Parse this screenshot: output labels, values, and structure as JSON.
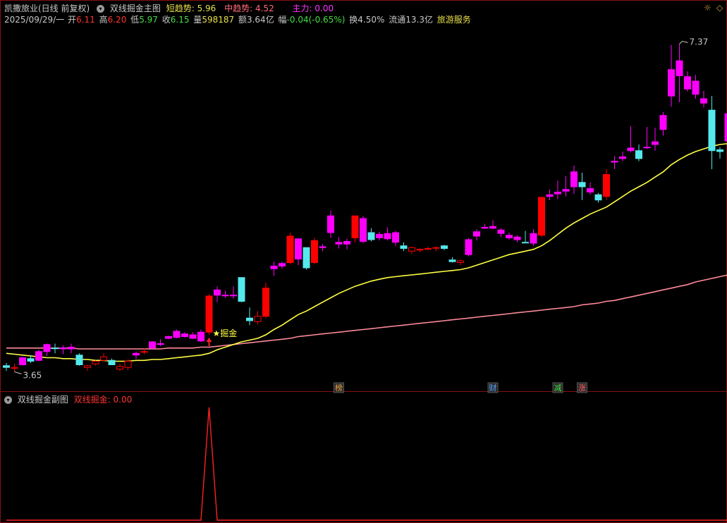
{
  "header": {
    "stock_name": "凯撒旅业(日线 前复权)",
    "indicator_name": "双线掘金主图",
    "short_trend_label": "短趋势:",
    "short_trend_value": "5.96",
    "mid_trend_label": "中趋势:",
    "mid_trend_value": "4.52",
    "main_force_label": "主力:",
    "main_force_value": "0.00"
  },
  "quote": {
    "date": "2025/09/29/一",
    "open_label": "开",
    "open_value": "6.11",
    "high_label": "高",
    "high_value": "6.20",
    "low_label": "低",
    "low_value": "5.97",
    "close_label": "收",
    "close_value": "6.15",
    "volume_label": "量",
    "volume_value": "598187",
    "amount_label": "额",
    "amount_value": "3.64亿",
    "change_label": "幅",
    "change_value": "-0.04(-0.65%)",
    "turnover_label": "换",
    "turnover_value": "4.50%",
    "float_label": "流通",
    "float_value": "13.3亿",
    "sector": "旅游服务"
  },
  "sub_panel": {
    "title": "双线掘金副图",
    "indicator_label": "双线掘金:",
    "indicator_value": "0.00"
  },
  "annotations": {
    "max_price": "7.37",
    "min_price": "3.65",
    "signal_label": "★掘金",
    "events": [
      "榜",
      "财",
      "减",
      "涨"
    ]
  },
  "colors": {
    "background": "#000000",
    "up": "#ff0000",
    "down": "#55e8ec",
    "signal_up": "#ff00ff",
    "ma_short": "#ffff44",
    "ma_long": "#ff8a9a",
    "text_yellow": "#e8e04a",
    "text_red": "#ff3333",
    "text_magenta": "#ff33ff",
    "text_green": "#44dd44",
    "text_grey": "#c8c8c8"
  },
  "chart_data": {
    "type": "candlestick",
    "candles": [
      {
        "o": 3.72,
        "h": 3.75,
        "l": 3.66,
        "c": 3.7,
        "k": "d"
      },
      {
        "o": 3.7,
        "h": 3.74,
        "l": 3.65,
        "c": 3.69,
        "k": "u"
      },
      {
        "o": 3.73,
        "h": 3.82,
        "l": 3.72,
        "c": 3.81,
        "k": "m"
      },
      {
        "o": 3.8,
        "h": 3.84,
        "l": 3.75,
        "c": 3.77,
        "k": "d"
      },
      {
        "o": 3.78,
        "h": 3.9,
        "l": 3.77,
        "c": 3.88,
        "k": "m"
      },
      {
        "o": 3.88,
        "h": 3.97,
        "l": 3.83,
        "c": 3.96,
        "k": "m"
      },
      {
        "o": 3.92,
        "h": 3.97,
        "l": 3.86,
        "c": 3.92,
        "k": "d"
      },
      {
        "o": 3.91,
        "h": 3.95,
        "l": 3.85,
        "c": 3.92,
        "k": "m"
      },
      {
        "o": 3.93,
        "h": 3.97,
        "l": 3.86,
        "c": 3.91,
        "k": "m"
      },
      {
        "o": 3.84,
        "h": 3.86,
        "l": 3.72,
        "c": 3.73,
        "k": "d"
      },
      {
        "o": 3.7,
        "h": 3.73,
        "l": 3.66,
        "c": 3.72,
        "k": "u"
      },
      {
        "o": 3.74,
        "h": 3.78,
        "l": 3.72,
        "c": 3.77,
        "k": "u"
      },
      {
        "o": 3.78,
        "h": 3.86,
        "l": 3.77,
        "c": 3.82,
        "k": "u"
      },
      {
        "o": 3.78,
        "h": 3.8,
        "l": 3.73,
        "c": 3.73,
        "k": "d"
      },
      {
        "o": 3.68,
        "h": 3.74,
        "l": 3.66,
        "c": 3.71,
        "k": "u"
      },
      {
        "o": 3.7,
        "h": 3.79,
        "l": 3.67,
        "c": 3.77,
        "k": "u"
      },
      {
        "o": 3.86,
        "h": 3.88,
        "l": 3.8,
        "c": 3.84,
        "k": "m"
      },
      {
        "o": 3.88,
        "h": 3.92,
        "l": 3.85,
        "c": 3.88,
        "k": "u"
      },
      {
        "o": 3.92,
        "h": 4.0,
        "l": 3.91,
        "c": 3.99,
        "k": "m"
      },
      {
        "o": 3.96,
        "h": 4.02,
        "l": 3.94,
        "c": 3.97,
        "k": "m"
      },
      {
        "o": 4.03,
        "h": 4.06,
        "l": 4.02,
        "c": 4.05,
        "k": "m"
      },
      {
        "o": 4.04,
        "h": 4.13,
        "l": 4.03,
        "c": 4.11,
        "k": "m"
      },
      {
        "o": 4.05,
        "h": 4.1,
        "l": 4.04,
        "c": 4.08,
        "k": "m"
      },
      {
        "o": 4.03,
        "h": 4.1,
        "l": 4.02,
        "c": 4.07,
        "k": "m"
      },
      {
        "o": 4.0,
        "h": 4.13,
        "l": 3.99,
        "c": 4.1,
        "k": "m"
      },
      {
        "o": 4.1,
        "h": 4.53,
        "l": 4.07,
        "c": 4.51,
        "k": "u"
      },
      {
        "o": 4.52,
        "h": 4.62,
        "l": 4.44,
        "c": 4.58,
        "k": "m"
      },
      {
        "o": 4.52,
        "h": 4.57,
        "l": 4.49,
        "c": 4.52,
        "k": "m"
      },
      {
        "o": 4.52,
        "h": 4.62,
        "l": 4.48,
        "c": 4.52,
        "k": "m"
      },
      {
        "o": 4.45,
        "h": 4.72,
        "l": 4.44,
        "c": 4.72,
        "k": "d"
      },
      {
        "o": 4.23,
        "h": 4.38,
        "l": 4.18,
        "c": 4.26,
        "k": "d"
      },
      {
        "o": 4.22,
        "h": 4.34,
        "l": 4.19,
        "c": 4.28,
        "k": "u"
      },
      {
        "o": 4.28,
        "h": 4.66,
        "l": 4.26,
        "c": 4.6,
        "k": "u"
      },
      {
        "o": 4.82,
        "h": 4.9,
        "l": 4.74,
        "c": 4.85,
        "k": "m"
      },
      {
        "o": 4.85,
        "h": 4.9,
        "l": 4.82,
        "c": 4.88,
        "k": "m"
      },
      {
        "o": 4.89,
        "h": 5.23,
        "l": 4.87,
        "c": 5.19,
        "k": "u"
      },
      {
        "o": 4.93,
        "h": 5.16,
        "l": 4.86,
        "c": 5.16,
        "k": "m"
      },
      {
        "o": 4.83,
        "h": 5.06,
        "l": 4.81,
        "c": 5.06,
        "k": "d"
      },
      {
        "o": 4.89,
        "h": 5.17,
        "l": 4.87,
        "c": 5.14,
        "k": "u"
      },
      {
        "o": 5.07,
        "h": 5.1,
        "l": 5.02,
        "c": 5.06,
        "k": "m"
      },
      {
        "o": 5.42,
        "h": 5.48,
        "l": 5.17,
        "c": 5.23,
        "k": "m"
      },
      {
        "o": 5.12,
        "h": 5.18,
        "l": 5.05,
        "c": 5.1,
        "k": "m"
      },
      {
        "o": 5.1,
        "h": 5.16,
        "l": 5.04,
        "c": 5.13,
        "k": "m"
      },
      {
        "o": 5.17,
        "h": 5.42,
        "l": 5.12,
        "c": 5.42,
        "k": "u"
      },
      {
        "o": 5.39,
        "h": 5.42,
        "l": 5.11,
        "c": 5.13,
        "k": "m"
      },
      {
        "o": 5.15,
        "h": 5.28,
        "l": 5.13,
        "c": 5.23,
        "k": "d"
      },
      {
        "o": 5.21,
        "h": 5.24,
        "l": 5.14,
        "c": 5.17,
        "k": "m"
      },
      {
        "o": 5.16,
        "h": 5.29,
        "l": 5.14,
        "c": 5.22,
        "k": "m"
      },
      {
        "o": 5.23,
        "h": 5.25,
        "l": 5.08,
        "c": 5.12,
        "k": "m"
      },
      {
        "o": 5.08,
        "h": 5.12,
        "l": 5.02,
        "c": 5.05,
        "k": "d"
      },
      {
        "o": 5.02,
        "h": 5.07,
        "l": 4.99,
        "c": 5.06,
        "k": "u"
      },
      {
        "o": 5.04,
        "h": 5.05,
        "l": 5.01,
        "c": 5.04,
        "k": "u"
      },
      {
        "o": 5.04,
        "h": 5.07,
        "l": 5.03,
        "c": 5.05,
        "k": "u"
      },
      {
        "o": 5.06,
        "h": 5.07,
        "l": 5.02,
        "c": 5.06,
        "k": "u"
      },
      {
        "o": 5.08,
        "h": 5.09,
        "l": 5.03,
        "c": 5.05,
        "k": "d"
      },
      {
        "o": 4.92,
        "h": 4.95,
        "l": 4.89,
        "c": 4.9,
        "k": "d"
      },
      {
        "o": 4.89,
        "h": 4.92,
        "l": 4.86,
        "c": 4.91,
        "k": "u"
      },
      {
        "o": 4.98,
        "h": 5.17,
        "l": 4.96,
        "c": 5.15,
        "k": "m"
      },
      {
        "o": 5.19,
        "h": 5.27,
        "l": 5.14,
        "c": 5.24,
        "k": "m"
      },
      {
        "o": 5.29,
        "h": 5.33,
        "l": 5.27,
        "c": 5.28,
        "k": "m"
      },
      {
        "o": 5.3,
        "h": 5.37,
        "l": 5.27,
        "c": 5.28,
        "k": "m"
      },
      {
        "o": 5.26,
        "h": 5.28,
        "l": 5.18,
        "c": 5.22,
        "k": "m"
      },
      {
        "o": 5.2,
        "h": 5.23,
        "l": 5.15,
        "c": 5.17,
        "k": "m"
      },
      {
        "o": 5.18,
        "h": 5.2,
        "l": 5.12,
        "c": 5.15,
        "k": "m"
      },
      {
        "o": 5.12,
        "h": 5.25,
        "l": 5.11,
        "c": 5.12,
        "k": "d"
      },
      {
        "o": 5.11,
        "h": 5.27,
        "l": 5.08,
        "c": 5.22,
        "k": "m"
      },
      {
        "o": 5.2,
        "h": 5.64,
        "l": 5.18,
        "c": 5.63,
        "k": "u"
      },
      {
        "o": 5.64,
        "h": 5.72,
        "l": 5.6,
        "c": 5.66,
        "k": "m"
      },
      {
        "o": 5.67,
        "h": 5.82,
        "l": 5.61,
        "c": 5.69,
        "k": "m"
      },
      {
        "o": 5.7,
        "h": 5.87,
        "l": 5.64,
        "c": 5.72,
        "k": "m"
      },
      {
        "o": 5.75,
        "h": 5.99,
        "l": 5.67,
        "c": 5.92,
        "k": "m"
      },
      {
        "o": 5.75,
        "h": 5.91,
        "l": 5.6,
        "c": 5.8,
        "k": "d"
      },
      {
        "o": 5.73,
        "h": 5.8,
        "l": 5.66,
        "c": 5.69,
        "k": "m"
      },
      {
        "o": 5.66,
        "h": 5.68,
        "l": 5.57,
        "c": 5.6,
        "k": "d"
      },
      {
        "o": 5.64,
        "h": 5.95,
        "l": 5.6,
        "c": 5.89,
        "k": "u"
      },
      {
        "o": 6.03,
        "h": 6.1,
        "l": 5.95,
        "c": 6.04,
        "k": "m"
      },
      {
        "o": 6.07,
        "h": 6.15,
        "l": 6.04,
        "c": 6.09,
        "k": "m"
      },
      {
        "o": 6.16,
        "h": 6.44,
        "l": 6.14,
        "c": 6.19,
        "k": "m"
      },
      {
        "o": 6.16,
        "h": 6.23,
        "l": 6.04,
        "c": 6.07,
        "k": "d"
      },
      {
        "o": 6.2,
        "h": 6.43,
        "l": 6.18,
        "c": 6.2,
        "k": "m"
      },
      {
        "o": 6.26,
        "h": 6.42,
        "l": 6.16,
        "c": 6.23,
        "k": "m"
      },
      {
        "o": 6.56,
        "h": 6.6,
        "l": 6.33,
        "c": 6.4,
        "k": "m"
      },
      {
        "o": 6.78,
        "h": 7.36,
        "l": 6.66,
        "c": 7.08,
        "k": "m"
      },
      {
        "o": 7.18,
        "h": 7.37,
        "l": 6.71,
        "c": 7.01,
        "k": "m"
      },
      {
        "o": 7.0,
        "h": 7.06,
        "l": 6.83,
        "c": 6.86,
        "k": "m"
      },
      {
        "o": 6.95,
        "h": 7.02,
        "l": 6.75,
        "c": 6.8,
        "k": "m"
      },
      {
        "o": 6.75,
        "h": 6.84,
        "l": 6.65,
        "c": 6.7,
        "k": "m"
      },
      {
        "o": 6.62,
        "h": 6.78,
        "l": 5.95,
        "c": 6.16,
        "k": "d"
      },
      {
        "o": 6.17,
        "h": 6.2,
        "l": 6.07,
        "c": 6.15,
        "k": "d"
      },
      {
        "o": 6.58,
        "h": 6.61,
        "l": 6.24,
        "c": 6.27,
        "k": "m"
      },
      {
        "o": 6.56,
        "h": 6.59,
        "l": 6.16,
        "c": 6.2,
        "k": "d"
      },
      {
        "o": 6.11,
        "h": 6.2,
        "l": 5.97,
        "c": 6.15,
        "k": "u"
      }
    ],
    "ma_short": [
      3.86,
      3.85,
      3.84,
      3.83,
      3.82,
      3.81,
      3.81,
      3.8,
      3.8,
      3.79,
      3.79,
      3.78,
      3.78,
      3.77,
      3.77,
      3.77,
      3.78,
      3.78,
      3.79,
      3.79,
      3.8,
      3.81,
      3.82,
      3.83,
      3.84,
      3.86,
      3.9,
      3.93,
      3.96,
      3.99,
      4.01,
      4.03,
      4.07,
      4.13,
      4.18,
      4.24,
      4.3,
      4.34,
      4.39,
      4.44,
      4.49,
      4.54,
      4.58,
      4.62,
      4.65,
      4.68,
      4.7,
      4.72,
      4.73,
      4.74,
      4.75,
      4.76,
      4.77,
      4.78,
      4.79,
      4.8,
      4.81,
      4.83,
      4.86,
      4.89,
      4.92,
      4.95,
      4.98,
      5.0,
      5.02,
      5.04,
      5.08,
      5.14,
      5.21,
      5.28,
      5.34,
      5.39,
      5.44,
      5.48,
      5.52,
      5.58,
      5.64,
      5.7,
      5.75,
      5.8,
      5.86,
      5.92,
      6.0,
      6.06,
      6.11,
      6.15,
      6.18,
      6.21,
      6.23,
      6.24,
      6.25,
      6.26,
      6.26
    ],
    "ma_long": [
      3.92,
      3.92,
      3.92,
      3.92,
      3.92,
      3.92,
      3.92,
      3.92,
      3.92,
      3.91,
      3.91,
      3.91,
      3.91,
      3.91,
      3.91,
      3.91,
      3.91,
      3.91,
      3.91,
      3.91,
      3.92,
      3.92,
      3.92,
      3.92,
      3.93,
      3.93,
      3.94,
      3.95,
      3.96,
      3.97,
      3.98,
      3.99,
      4.0,
      4.01,
      4.02,
      4.03,
      4.05,
      4.06,
      4.07,
      4.08,
      4.09,
      4.1,
      4.11,
      4.12,
      4.13,
      4.14,
      4.15,
      4.16,
      4.17,
      4.18,
      4.19,
      4.2,
      4.21,
      4.22,
      4.23,
      4.24,
      4.25,
      4.26,
      4.27,
      4.28,
      4.29,
      4.3,
      4.31,
      4.32,
      4.33,
      4.34,
      4.35,
      4.36,
      4.37,
      4.38,
      4.39,
      4.41,
      4.42,
      4.43,
      4.45,
      4.46,
      4.48,
      4.5,
      4.52,
      4.54,
      4.56,
      4.58,
      4.6,
      4.62,
      4.64,
      4.67,
      4.69,
      4.71,
      4.73,
      4.75,
      4.77,
      4.78,
      4.78
    ],
    "signal": {
      "index": 25,
      "peak": 1,
      "y_axis": [
        0,
        1
      ]
    },
    "event_markers": [
      {
        "index": 41,
        "label": "榜"
      },
      {
        "index": 60,
        "label": "财"
      },
      {
        "index": 68,
        "label": "减"
      },
      {
        "index": 71,
        "label": "涨"
      }
    ],
    "ylim": [
      3.55,
      7.55
    ]
  }
}
